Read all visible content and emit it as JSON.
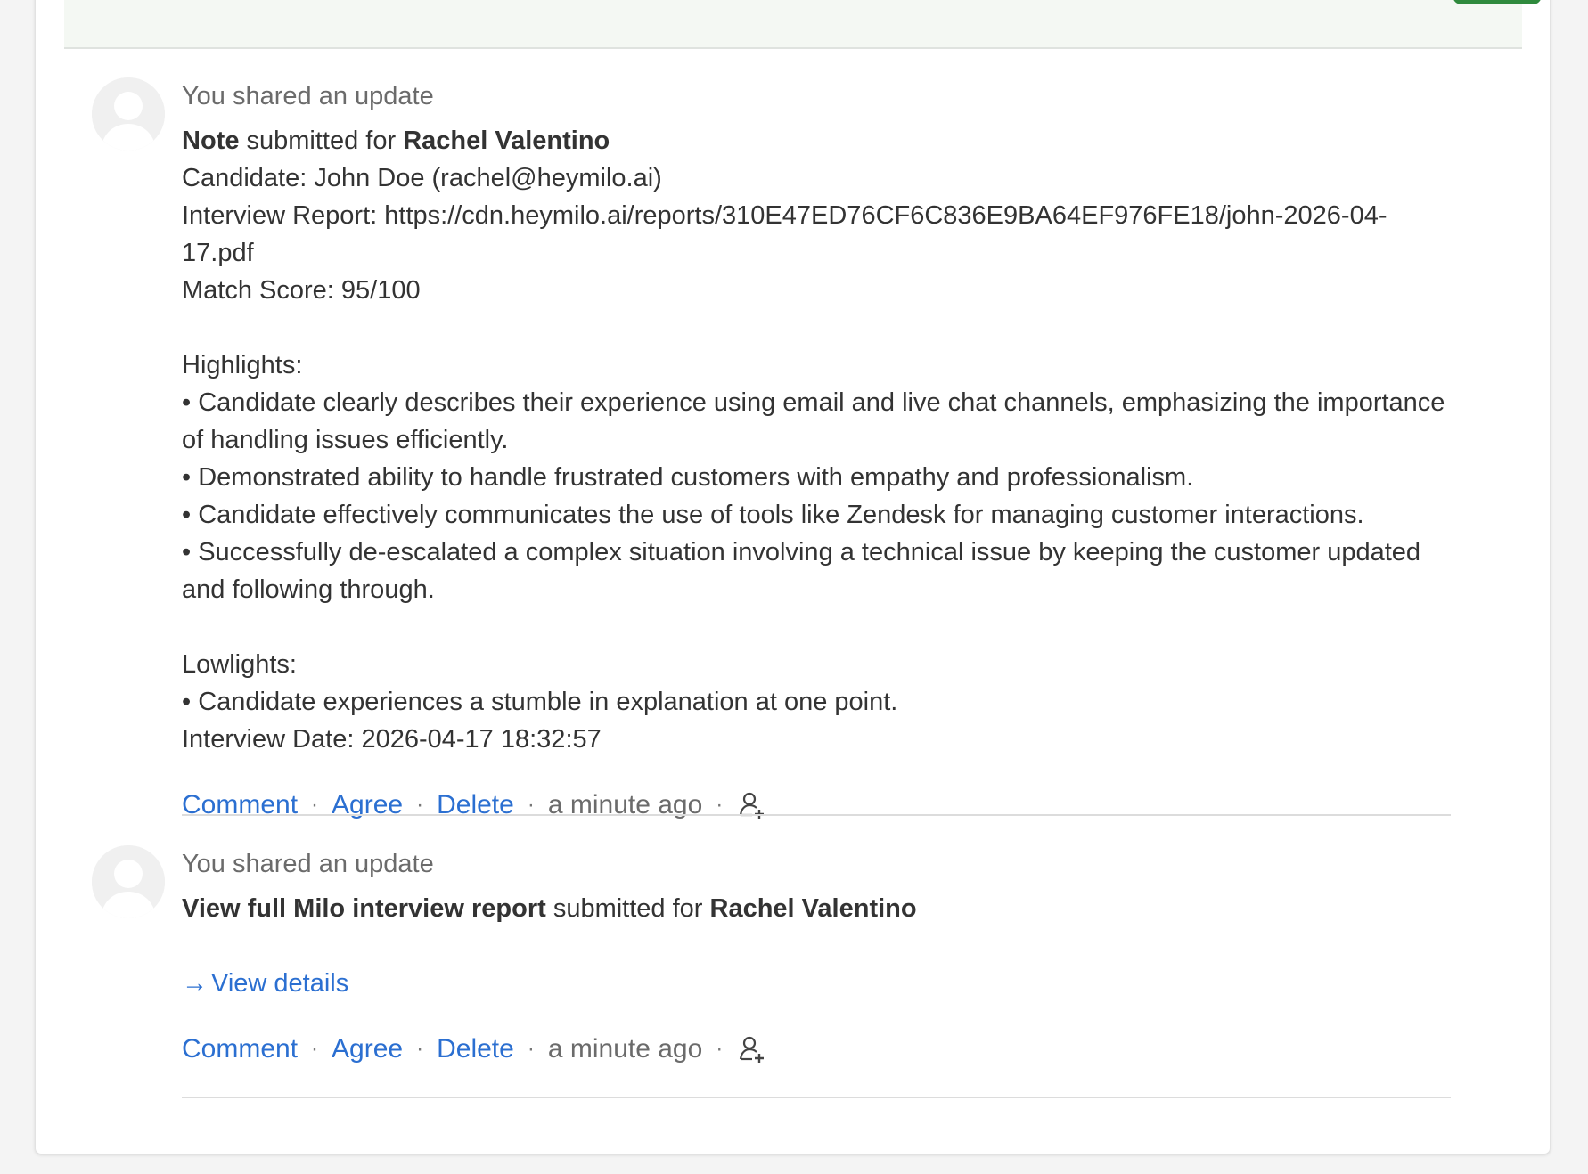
{
  "entries": [
    {
      "header": "You shared an update",
      "title": {
        "bold_type": "Note",
        "middle": " submitted for ",
        "bold_name": "Rachel Valentino"
      },
      "lines": [
        "Candidate: John Doe (rachel@heymilo.ai)",
        "Interview Report: https://cdn.heymilo.ai/reports/310E47ED76CF6C836E9BA64EF976FE18/john-2026-04-17.pdf",
        "Match Score: 95/100",
        "",
        "Highlights:",
        "• Candidate clearly describes their experience using email and live chat channels, emphasizing the importance of handling issues efficiently.",
        "• Demonstrated ability to handle frustrated customers with empathy and professionalism.",
        "• Candidate effectively communicates the use of tools like Zendesk for managing customer interactions.",
        "• Successfully de-escalated a complex situation involving a technical issue by keeping the customer updated and following through.",
        "",
        "Lowlights:",
        "• Candidate experiences a stumble in explanation at one point.",
        "Interview Date: 2026-04-17 18:32:57"
      ],
      "actions": {
        "comment": "Comment",
        "agree": "Agree",
        "delete": "Delete",
        "time": "a minute ago",
        "separator": "·"
      }
    },
    {
      "header": "You shared an update",
      "title": {
        "bold_type": "View full Milo interview report",
        "middle": " submitted for ",
        "bold_name": "Rachel Valentino"
      },
      "view_details": "View details",
      "view_details_arrow": "→",
      "actions": {
        "comment": "Comment",
        "agree": "Agree",
        "delete": "Delete",
        "time": "a minute ago",
        "separator": "·"
      }
    }
  ],
  "icons": {
    "avatar": "avatar-placeholder-icon",
    "add_person": "add-person-icon"
  },
  "colors": {
    "link": "#2b6fd1",
    "muted": "#6b6b6b",
    "text": "#333333",
    "accent_green": "#2f8a3d"
  }
}
